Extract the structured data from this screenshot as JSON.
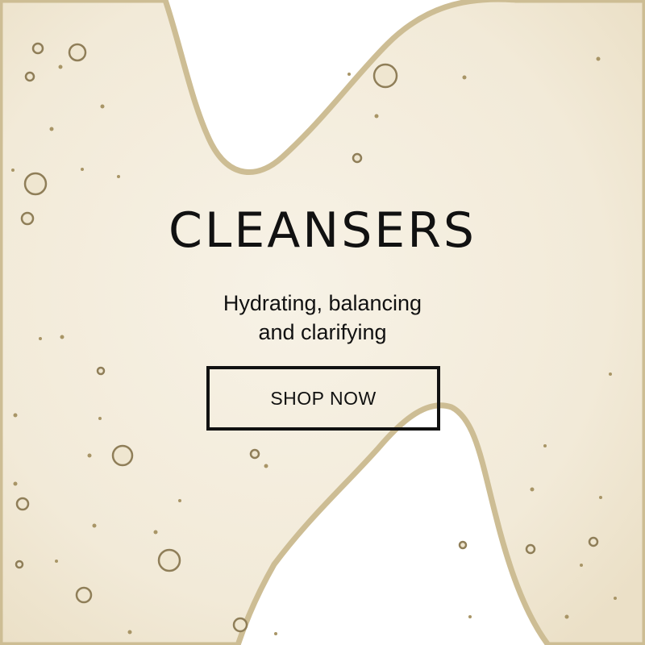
{
  "banner": {
    "title": "CLEANSERS",
    "subtitle_line1": "Hydrating, balancing",
    "subtitle_line2": "and clarifying",
    "cta_label": "SHOP NOW"
  },
  "colors": {
    "background": "#ffffff",
    "gel": "#f3ecdc",
    "gel_edge": "#c9b98f",
    "text": "#111111"
  },
  "image": {
    "subject": "cleanser-gel-swatch-with-bubbles"
  }
}
